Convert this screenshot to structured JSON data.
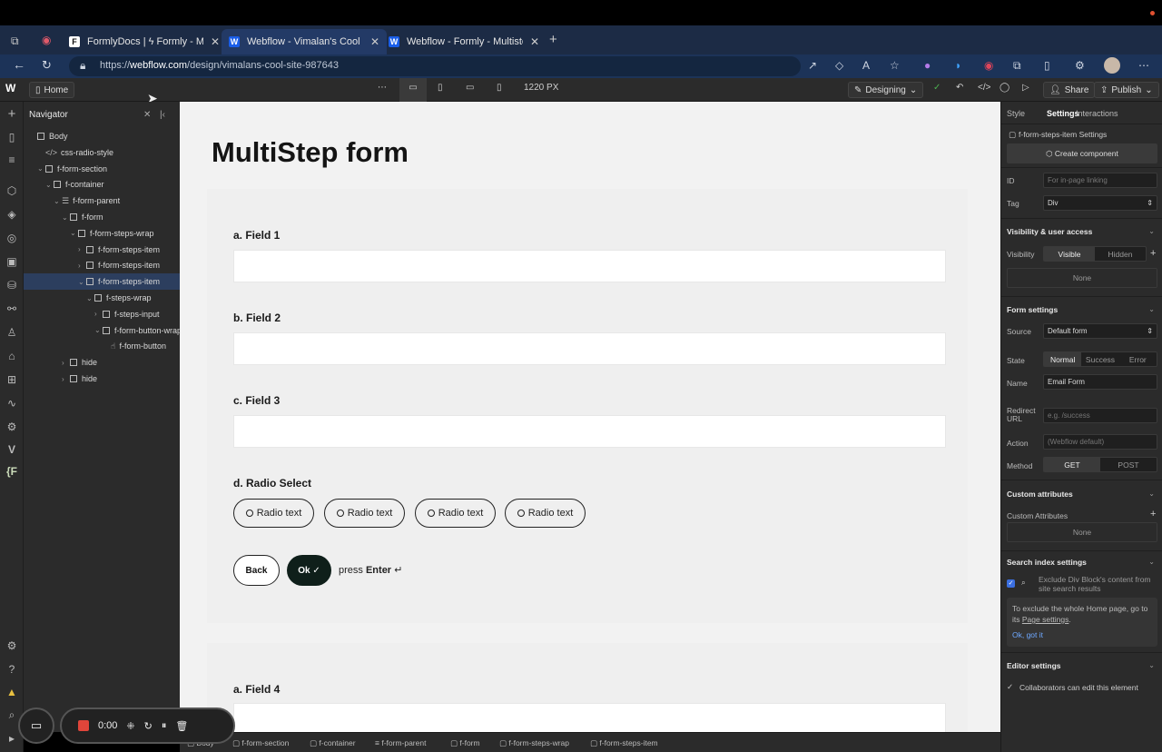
{
  "browser": {
    "tabs": [
      {
        "title": "FormlyDocs | ϟ Formly - Multi",
        "favicon": "F",
        "active": false
      },
      {
        "title": "Webflow - Vimalan's Cool Site",
        "favicon": "W",
        "active": true
      },
      {
        "title": "Webflow - Formly - Multistep F",
        "favicon": "W",
        "active": false
      }
    ],
    "url_prefix": "https://",
    "url_domain": "webflow.com",
    "url_path": "/design/vimalans-cool-site-987643"
  },
  "designer_top": {
    "home_label": "Home",
    "breakpoint_width": "1220 PX",
    "mode_label": "Designing",
    "share_label": "Share",
    "publish_label": "Publish"
  },
  "navigator": {
    "title": "Navigator",
    "nodes": [
      {
        "label": "Body",
        "indent": 0,
        "caret": "",
        "icon": "box"
      },
      {
        "label": "css-radio-style",
        "indent": 1,
        "caret": "",
        "icon": "code"
      },
      {
        "label": "f-form-section",
        "indent": 1,
        "caret": "⌄",
        "icon": "box"
      },
      {
        "label": "f-container",
        "indent": 2,
        "caret": "⌄",
        "icon": "box"
      },
      {
        "label": "f-form-parent",
        "indent": 3,
        "caret": "⌄",
        "icon": "form"
      },
      {
        "label": "f-form",
        "indent": 4,
        "caret": "⌄",
        "icon": "box"
      },
      {
        "label": "f-form-steps-wrap",
        "indent": 5,
        "caret": "⌄",
        "icon": "box"
      },
      {
        "label": "f-form-steps-item",
        "indent": 6,
        "caret": "›",
        "icon": "box"
      },
      {
        "label": "f-form-steps-item",
        "indent": 6,
        "caret": "›",
        "icon": "box"
      },
      {
        "label": "f-form-steps-item",
        "indent": 6,
        "caret": "⌄",
        "icon": "box",
        "selected": true
      },
      {
        "label": "f-steps-wrap",
        "indent": 7,
        "caret": "⌄",
        "icon": "box"
      },
      {
        "label": "f-steps-input",
        "indent": 8,
        "caret": "›",
        "icon": "box"
      },
      {
        "label": "f-form-button-wrap",
        "indent": 8,
        "caret": "⌄",
        "icon": "box"
      },
      {
        "label": "f-form-button",
        "indent": 9,
        "caret": "",
        "icon": "hand"
      },
      {
        "label": "hide",
        "indent": 4,
        "caret": "›",
        "icon": "box"
      },
      {
        "label": "hide",
        "indent": 4,
        "caret": "›",
        "icon": "box"
      }
    ]
  },
  "canvas": {
    "heading": "MultiStep form",
    "field1_label": "a. Field 1",
    "field2_label": "b. Field 2",
    "field3_label": "c. Field 3",
    "radio_label": "d. Radio Select",
    "radio_options": [
      "Radio text",
      "Radio text",
      "Radio text",
      "Radio text"
    ],
    "back_label": "Back",
    "ok_label": "Ok ✓",
    "hint_prefix": "press ",
    "hint_key": "Enter",
    "hint_icon": "↵",
    "field4_label": "a. Field 4"
  },
  "settings": {
    "tabs": [
      "Style",
      "Settings",
      "Interactions"
    ],
    "element_title": "f-form-steps-item Settings",
    "create_component": "Create component",
    "id_label": "ID",
    "id_placeholder": "For in-page linking",
    "tag_label": "Tag",
    "tag_value": "Div",
    "visibility_section": "Visibility & user access",
    "visibility_label": "Visibility",
    "visible": "Visible",
    "hidden": "Hidden",
    "none": "None",
    "form_section": "Form settings",
    "source_label": "Source",
    "source_value": "Default form",
    "state_label": "State",
    "state_normal": "Normal",
    "state_success": "Success",
    "state_error": "Error",
    "name_label": "Name",
    "name_value": "Email Form",
    "redirect_label": "Redirect URL",
    "redirect_placeholder": "e.g. /success",
    "action_label": "Action",
    "action_placeholder": "(Webflow default)",
    "method_label": "Method",
    "method_get": "GET",
    "method_post": "POST",
    "custom_attr_section": "Custom attributes",
    "custom_attr_label": "Custom Attributes",
    "search_section": "Search index settings",
    "exclude_text": "Exclude Div Block's content from site search results",
    "tip_text": "To exclude the whole Home page, go to its ",
    "tip_link": "Page settings",
    "tip_dismiss": "Ok, got it",
    "editor_section": "Editor settings",
    "collab_label": "Collaborators can edit this element"
  },
  "breadcrumbs": [
    "Body",
    "f-form-section",
    "f-container",
    "f-form-parent",
    "f-form",
    "f-form-steps-wrap",
    "f-form-steps-item"
  ],
  "recorder": {
    "time": "0:00"
  }
}
